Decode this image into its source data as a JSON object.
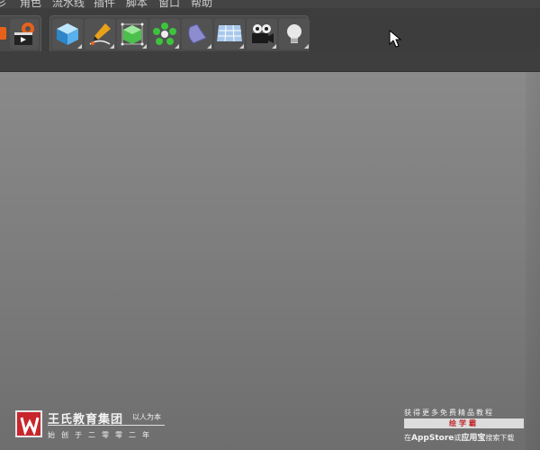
{
  "menubar": {
    "items": [
      "彡",
      "角色",
      "流水线",
      "插件",
      "脚本",
      "窗口",
      "帮助"
    ]
  },
  "toolbar": {
    "left_group": [
      {
        "icon": "render-settings-icon"
      },
      {
        "icon": "render-to-picture-viewer-icon"
      }
    ],
    "create_group": [
      {
        "icon": "cube-primitive-icon"
      },
      {
        "icon": "pen-spline-icon"
      },
      {
        "icon": "subdivision-surface-icon"
      },
      {
        "icon": "array-generator-icon"
      },
      {
        "icon": "bend-deformer-icon"
      },
      {
        "icon": "floor-environment-icon"
      },
      {
        "icon": "camera-icon"
      },
      {
        "icon": "light-icon"
      }
    ]
  },
  "watermark": {
    "brand_name": "王氏教育集团",
    "slogan": "以人为本",
    "founded": "始创于二零零二年",
    "promo_top": "获得更多免费精品教程",
    "promo_app": "绘学霸",
    "promo_bottom_prefix": "在",
    "promo_bottom_store1": "AppStore",
    "promo_bottom_or": "或",
    "promo_bottom_store2": "应用宝",
    "promo_bottom_suffix": "搜索下载"
  },
  "colors": {
    "viewport": "#7f7f7f",
    "toolbar": "#3d3d3d",
    "brand_red": "#c8262c"
  }
}
